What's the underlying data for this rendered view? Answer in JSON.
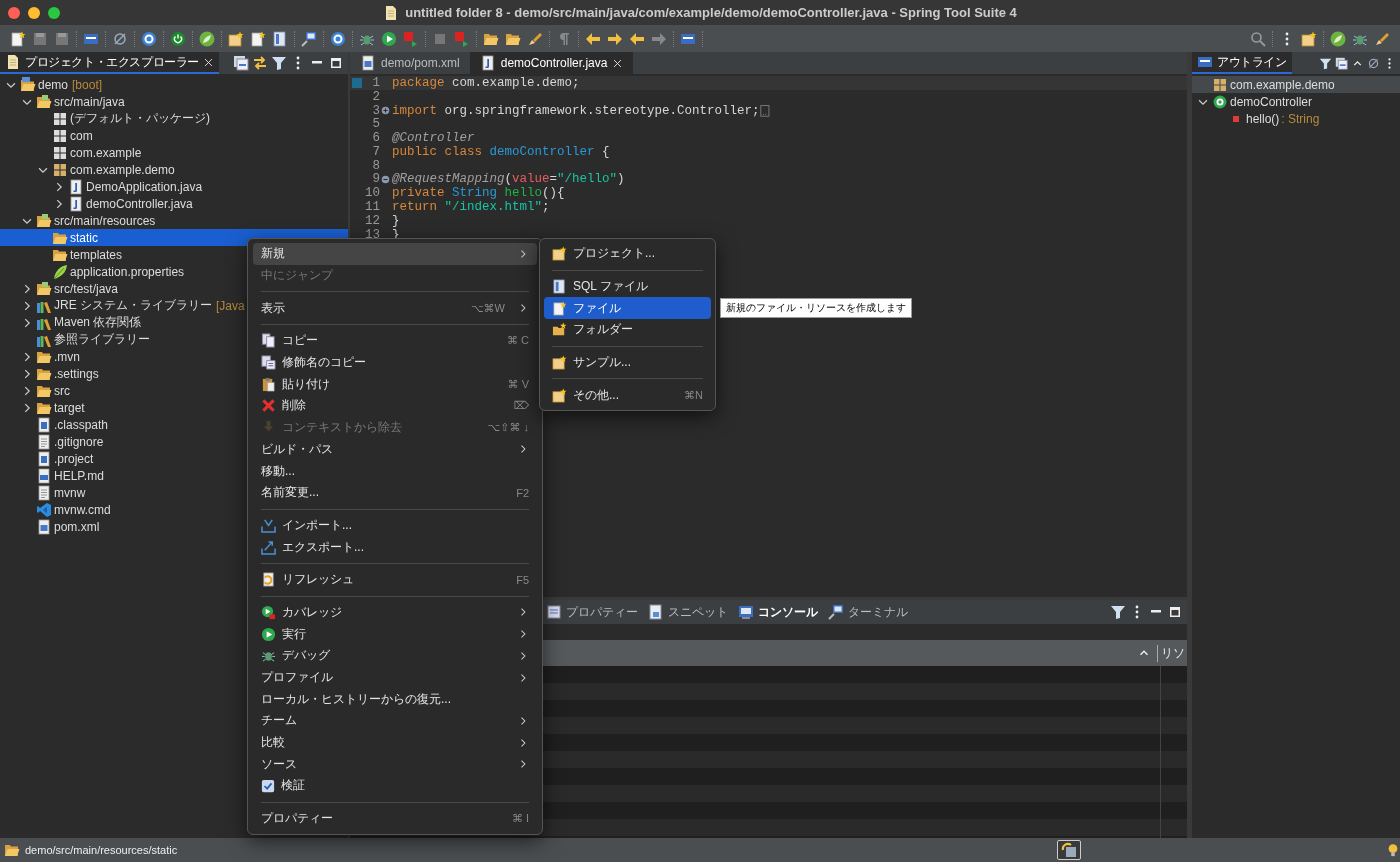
{
  "window": {
    "title": "untitled folder 8 - demo/src/main/java/com/example/demo/demoController.java - Spring Tool Suite 4"
  },
  "explorer": {
    "tab": {
      "label": "プロジェクト・エクスプローラー",
      "selected": true
    },
    "tree": [
      {
        "label": "demo",
        "suffix": "[boot]",
        "kind": "project",
        "expanded": true,
        "selected": false,
        "children": [
          {
            "label": "src/main/java",
            "kind": "source-folder",
            "expanded": true,
            "selected": false,
            "children": [
              {
                "label": "(デフォルト・パッケージ)",
                "kind": "package-empty",
                "selected": false
              },
              {
                "label": "com",
                "kind": "package-empty",
                "selected": false
              },
              {
                "label": "com.example",
                "kind": "package-empty",
                "selected": false
              },
              {
                "label": "com.example.demo",
                "kind": "package",
                "expanded": true,
                "selected": false,
                "children": [
                  {
                    "label": "DemoApplication.java",
                    "kind": "java",
                    "expanded": false,
                    "selected": false
                  },
                  {
                    "label": "demoController.java",
                    "kind": "java",
                    "expanded": false,
                    "selected": false
                  }
                ]
              }
            ]
          },
          {
            "label": "src/main/resources",
            "kind": "source-folder",
            "expanded": true,
            "selected": false,
            "children": [
              {
                "label": "static",
                "kind": "folder",
                "selected": true
              },
              {
                "label": "templates",
                "kind": "folder",
                "selected": false
              },
              {
                "label": "application.properties",
                "kind": "leaf",
                "selected": false
              }
            ]
          },
          {
            "label": "src/test/java",
            "kind": "source-folder",
            "expanded": false,
            "selected": false
          },
          {
            "label": "JRE システム・ライブラリー",
            "suffix": "[Java",
            "kind": "library",
            "expanded": false,
            "selected": false
          },
          {
            "label": "Maven 依存関係",
            "kind": "library",
            "expanded": false,
            "selected": false
          },
          {
            "label": "参照ライブラリー",
            "kind": "library",
            "selected": false
          },
          {
            "label": ".mvn",
            "kind": "folder",
            "expanded": false,
            "selected": false
          },
          {
            "label": ".settings",
            "kind": "folder",
            "expanded": false,
            "selected": false
          },
          {
            "label": "src",
            "kind": "folder",
            "expanded": false,
            "selected": false
          },
          {
            "label": "target",
            "kind": "folder",
            "expanded": false,
            "selected": false
          },
          {
            "label": ".classpath",
            "kind": "xml",
            "selected": false
          },
          {
            "label": ".gitignore",
            "kind": "text",
            "selected": false
          },
          {
            "label": ".project",
            "kind": "xml",
            "selected": false
          },
          {
            "label": "HELP.md",
            "kind": "document",
            "selected": false
          },
          {
            "label": "mvnw",
            "kind": "text",
            "selected": false
          },
          {
            "label": "mvnw.cmd",
            "kind": "script",
            "selected": false
          },
          {
            "label": "pom.xml",
            "kind": "pom",
            "selected": false
          }
        ]
      }
    ]
  },
  "editor": {
    "tabs": [
      {
        "label": "demo/pom.xml",
        "kind": "pom",
        "selected": false
      },
      {
        "label": "demoController.java",
        "kind": "java",
        "selected": true
      }
    ],
    "lines": [
      {
        "number": "1",
        "current": true,
        "tokens": [
          {
            "text": "package",
            "kind": "keyword"
          },
          {
            "text": " com.example.demo;",
            "kind": "plain"
          }
        ]
      },
      {
        "number": "2",
        "current": false
      },
      {
        "number": "3",
        "current": false,
        "folded": true,
        "tokens": [
          {
            "text": "import",
            "kind": "keyword"
          },
          {
            "text": " org.springframework.stereotype.Controller;",
            "kind": "plain"
          }
        ]
      },
      {
        "number": "5",
        "current": false
      },
      {
        "number": "6",
        "current": false,
        "tokens": [
          {
            "text": "@Controller",
            "kind": "annotation"
          }
        ]
      },
      {
        "number": "7",
        "current": false,
        "tokens": [
          {
            "text": "public class ",
            "kind": "keyword"
          },
          {
            "text": "demoController",
            "kind": "type"
          },
          {
            "text": " {",
            "kind": "plain"
          }
        ]
      },
      {
        "number": "8",
        "current": false
      },
      {
        "number": "9",
        "current": false,
        "folded": false,
        "tokens": [
          {
            "text": "@RequestMapping",
            "kind": "annotation"
          },
          {
            "text": "(",
            "kind": "plain"
          },
          {
            "text": "value",
            "kind": "param"
          },
          {
            "text": "=",
            "kind": "plain"
          },
          {
            "text": "\"/hello\"",
            "kind": "string"
          },
          {
            "text": ")",
            "kind": "plain"
          }
        ]
      },
      {
        "number": "10",
        "current": false,
        "tokens": [
          {
            "text": "private ",
            "kind": "keyword"
          },
          {
            "text": "String ",
            "kind": "type"
          },
          {
            "text": "hello",
            "kind": "method"
          },
          {
            "text": "(){",
            "kind": "plain"
          }
        ]
      },
      {
        "number": "11",
        "current": false,
        "tokens": [
          {
            "text": "return ",
            "kind": "keyword"
          },
          {
            "text": "\"/index.html\"",
            "kind": "string"
          },
          {
            "text": ";",
            "kind": "plain"
          }
        ]
      },
      {
        "number": "12",
        "current": false,
        "tokens": [
          {
            "text": "}",
            "kind": "plain"
          }
        ]
      },
      {
        "number": "13",
        "current": false,
        "tokens": [
          {
            "text": "}",
            "kind": "plain"
          }
        ]
      }
    ]
  },
  "outline": {
    "tab": {
      "label": "アウトライン",
      "selected": true
    },
    "tree": [
      {
        "label": "com.example.demo",
        "kind": "package",
        "selected": true
      },
      {
        "label": "demoController",
        "kind": "class",
        "expanded": true,
        "selected": false,
        "children": [
          {
            "label": "hello()",
            "type": " : String",
            "kind": "method",
            "selected": false
          }
        ]
      }
    ]
  },
  "bottom_panel": {
    "tabs": [
      {
        "label": "プロパティー",
        "kind": "properties",
        "selected": false
      },
      {
        "label": "スニペット",
        "kind": "snippets",
        "selected": false
      },
      {
        "label": "コンソール",
        "kind": "console",
        "selected": true
      },
      {
        "label": "ターミナル",
        "kind": "terminal",
        "selected": false
      }
    ],
    "table": {
      "columns": [
        {
          "label": "リソ"
        }
      ]
    }
  },
  "context_menu": {
    "items": [
      {
        "kind": "plain",
        "label": "新規",
        "submenu": true,
        "disabled": false,
        "selected": true
      },
      {
        "kind": "plain",
        "label": "中にジャンプ",
        "submenu": false,
        "disabled": true,
        "selected": false
      },
      {
        "kind": "separator"
      },
      {
        "kind": "plain",
        "label": "表示",
        "shortcut": "⌥⌘W",
        "submenu": true,
        "disabled": false,
        "selected": false
      },
      {
        "kind": "separator"
      },
      {
        "kind": "copy",
        "label": "コピー",
        "shortcut": "⌘ C",
        "submenu": false,
        "disabled": false,
        "selected": false
      },
      {
        "kind": "copy-name",
        "label": "修飾名のコピー",
        "submenu": false,
        "disabled": false,
        "selected": false
      },
      {
        "kind": "paste",
        "label": "貼り付け",
        "shortcut": "⌘ V",
        "submenu": false,
        "disabled": false,
        "selected": false
      },
      {
        "kind": "delete",
        "label": "削除",
        "shortcut": "⌦",
        "submenu": false,
        "disabled": false,
        "selected": false
      },
      {
        "kind": "remove",
        "label": "コンテキストから除去",
        "shortcut": "⌥⇧⌘ ↓",
        "submenu": false,
        "disabled": true,
        "selected": false
      },
      {
        "kind": "plain",
        "label": "ビルド・パス",
        "submenu": true,
        "disabled": false,
        "selected": false
      },
      {
        "kind": "plain",
        "label": "移動...",
        "submenu": false,
        "disabled": false,
        "selected": false
      },
      {
        "kind": "plain",
        "label": "名前変更...",
        "shortcut": "F2",
        "submenu": false,
        "disabled": false,
        "selected": false
      },
      {
        "kind": "separator"
      },
      {
        "kind": "import",
        "label": "インポート...",
        "submenu": false,
        "disabled": false,
        "selected": false
      },
      {
        "kind": "export",
        "label": "エクスポート...",
        "submenu": false,
        "disabled": false,
        "selected": false
      },
      {
        "kind": "separator"
      },
      {
        "kind": "refresh",
        "label": "リフレッシュ",
        "shortcut": "F5",
        "submenu": false,
        "disabled": false,
        "selected": false
      },
      {
        "kind": "separator"
      },
      {
        "kind": "coverage",
        "label": "カバレッジ",
        "submenu": true,
        "disabled": false,
        "selected": false
      },
      {
        "kind": "run",
        "label": "実行",
        "submenu": true,
        "disabled": false,
        "selected": false
      },
      {
        "kind": "debug",
        "label": "デバッグ",
        "submenu": true,
        "disabled": false,
        "selected": false
      },
      {
        "kind": "plain",
        "label": "プロファイル",
        "submenu": true,
        "disabled": false,
        "selected": false
      },
      {
        "kind": "plain",
        "label": "ローカル・ヒストリーからの復元...",
        "submenu": false,
        "disabled": false,
        "selected": false
      },
      {
        "kind": "plain",
        "label": "チーム",
        "submenu": true,
        "disabled": false,
        "selected": false
      },
      {
        "kind": "plain",
        "label": "比較",
        "submenu": true,
        "disabled": false,
        "selected": false
      },
      {
        "kind": "plain",
        "label": "ソース",
        "submenu": true,
        "disabled": false,
        "selected": false
      },
      {
        "kind": "check",
        "label": "検証",
        "checked": true,
        "submenu": false,
        "disabled": false,
        "selected": false
      },
      {
        "kind": "separator"
      },
      {
        "kind": "plain",
        "label": "プロパティー",
        "shortcut": "⌘ I",
        "submenu": false,
        "disabled": false,
        "selected": false
      }
    ]
  },
  "submenu": {
    "items": [
      {
        "kind": "new-project",
        "label": "プロジェクト...",
        "selected": false
      },
      {
        "kind": "separator"
      },
      {
        "kind": "sql",
        "label": "SQL ファイル",
        "selected": false
      },
      {
        "kind": "new-file",
        "label": "ファイル",
        "selected": true
      },
      {
        "kind": "new-folder",
        "label": "フォルダー",
        "selected": false
      },
      {
        "kind": "separator"
      },
      {
        "kind": "new-project",
        "label": "サンプル...",
        "selected": false
      },
      {
        "kind": "separator"
      },
      {
        "kind": "new-project",
        "label": "その他...",
        "shortcut": "⌘N",
        "selected": false
      }
    ]
  },
  "tooltip": {
    "text": "新規のファイル・リソースを作成します"
  },
  "status_bar": {
    "path": "demo/src/main/resources/static"
  }
}
